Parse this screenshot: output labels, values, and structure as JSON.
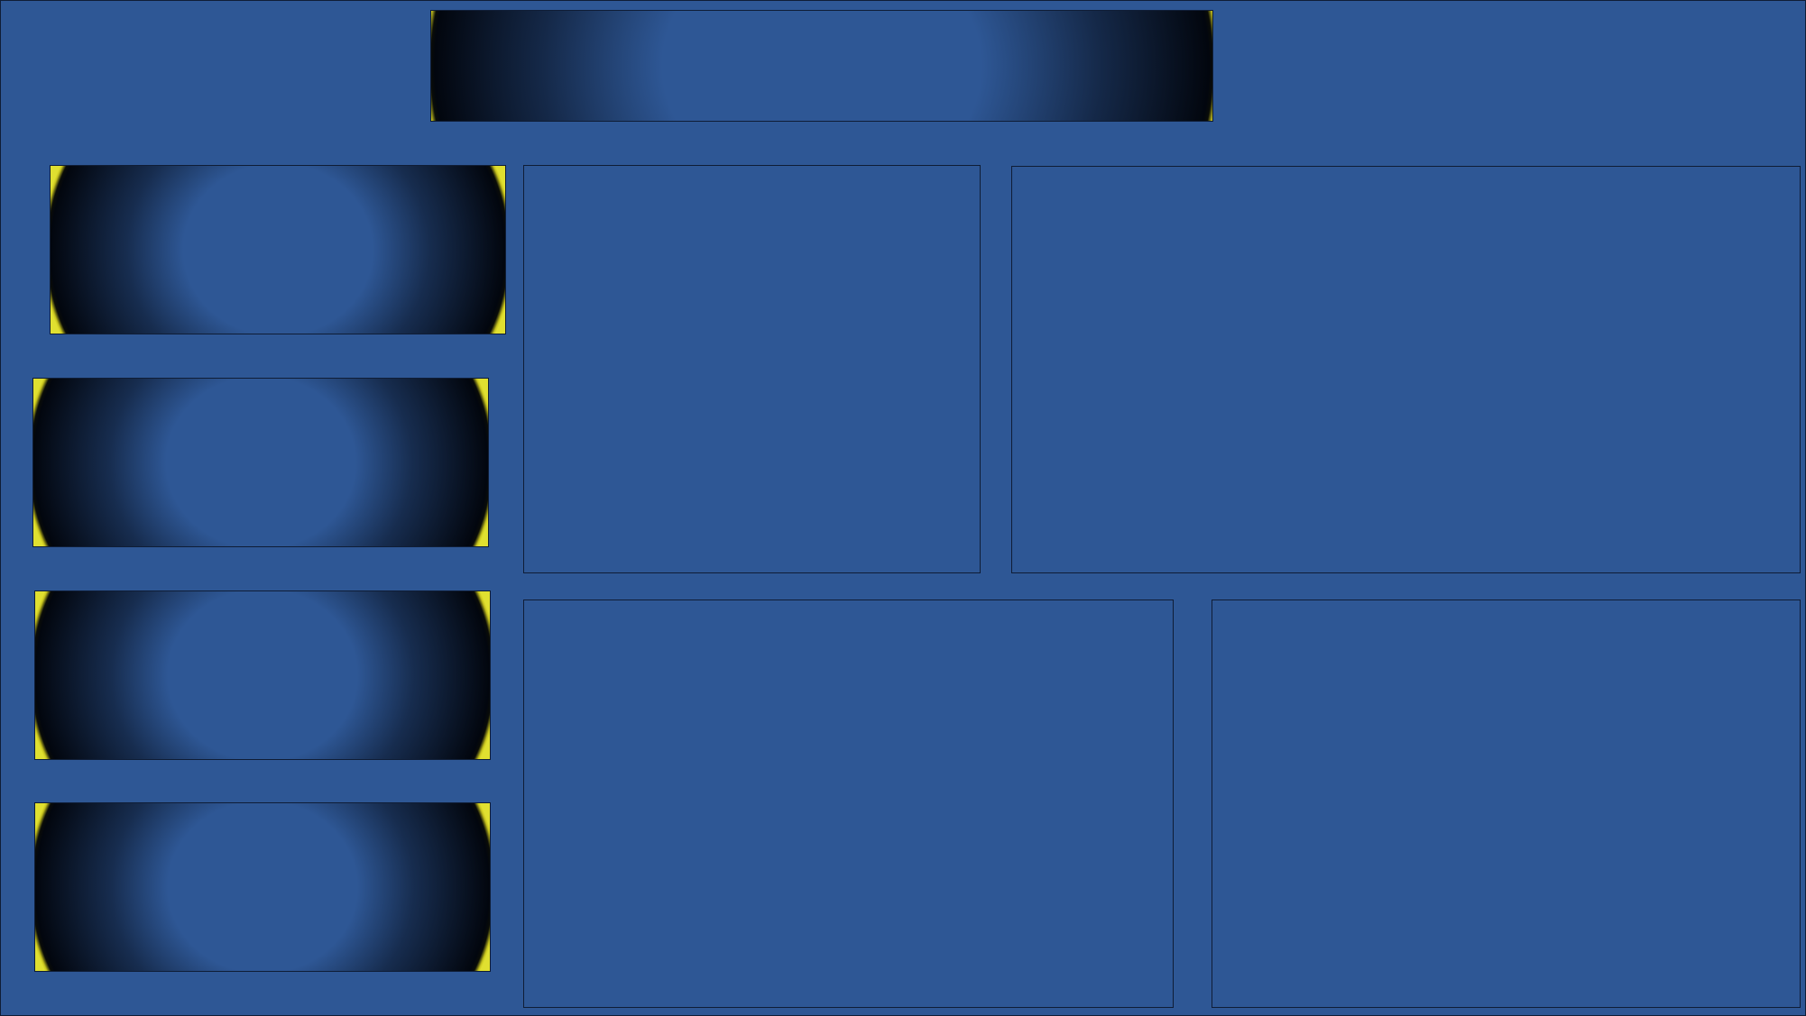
{
  "palette": {
    "background": "#2e5795",
    "border": "#0f1d36",
    "edge_glow": "#e0e030",
    "shadow": "#02060e"
  },
  "banner": {},
  "side_cards": [
    {},
    {},
    {},
    {}
  ],
  "panels": [
    {},
    {},
    {},
    {}
  ]
}
